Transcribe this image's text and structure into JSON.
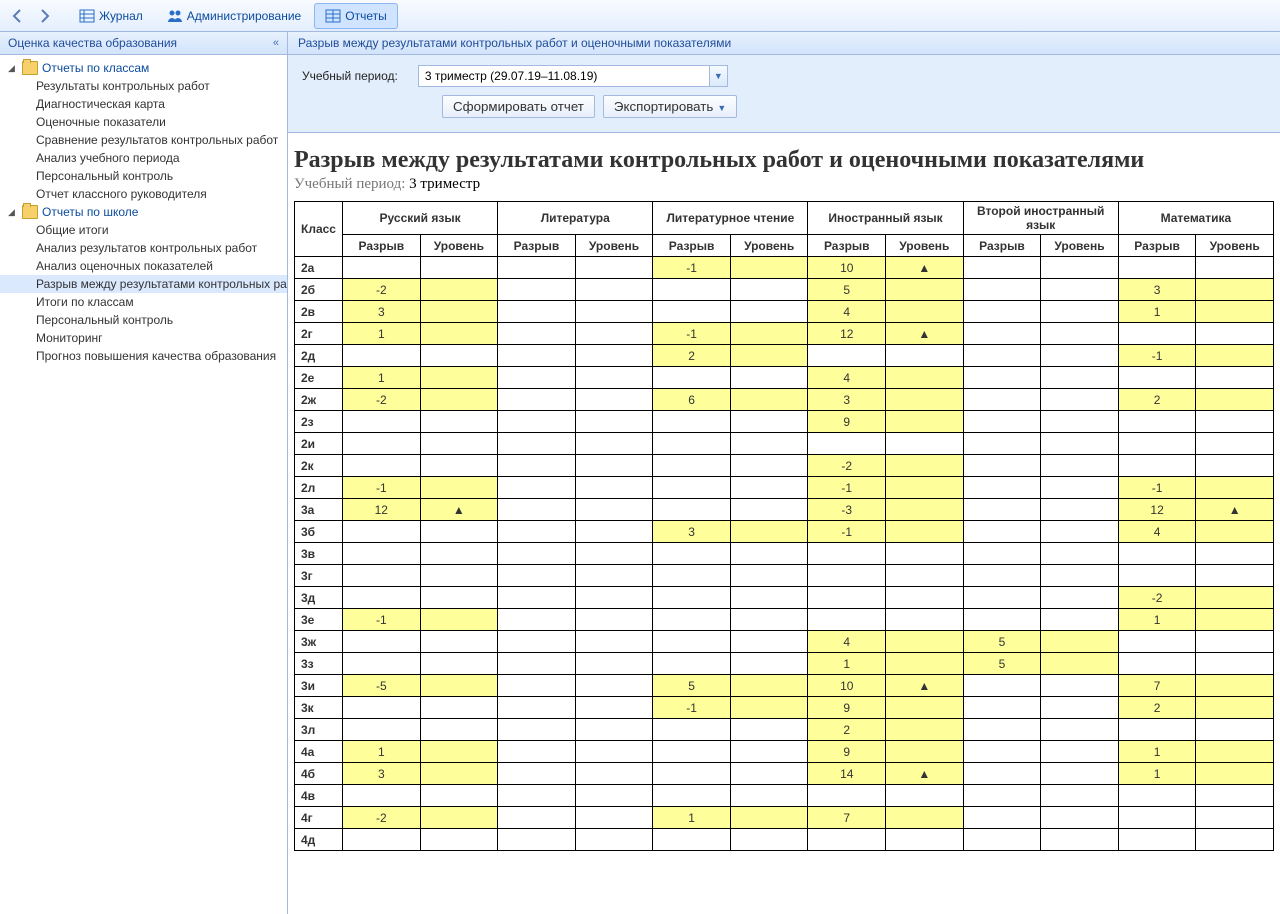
{
  "toolbar": {
    "tabs": [
      {
        "label": "Журнал"
      },
      {
        "label": "Администрирование"
      },
      {
        "label": "Отчеты"
      }
    ]
  },
  "sidebar": {
    "title": "Оценка качества образования",
    "groups": [
      {
        "label": "Отчеты по классам",
        "items": [
          "Результаты контрольных работ",
          "Диагностическая карта",
          "Оценочные показатели",
          "Сравнение результатов контрольных работ",
          "Анализ учебного периода",
          "Персональный контроль",
          "Отчет классного руководителя"
        ]
      },
      {
        "label": "Отчеты по школе",
        "items": [
          "Общие итоги",
          "Анализ результатов контрольных работ",
          "Анализ оценочных показателей",
          "Разрыв между результатами контрольных работ и оценочными показателями",
          "Итоги по классам",
          "Персональный контроль",
          "Мониторинг",
          "Прогноз повышения качества образования"
        ]
      }
    ],
    "selected": "Разрыв между результатами контрольных работ и оценочными показателями"
  },
  "main": {
    "header": "Разрыв между результатами контрольных работ и оценочными показателями",
    "period_label": "Учебный период:",
    "period_value": "3 триместр (29.07.19–11.08.19)",
    "generate_button": "Сформировать отчет",
    "export_button": "Экспортировать",
    "report_title": "Разрыв между результатами контрольных работ и оценочными показателями",
    "report_sub_label": "Учебный период:",
    "report_sub_value": "3 триместр"
  },
  "table": {
    "class_header": "Класс",
    "subcols": [
      "Разрыв",
      "Уровень"
    ],
    "subjects": [
      "Русский язык",
      "Литература",
      "Литературное чтение",
      "Иностранный язык",
      "Второй иностранный язык",
      "Математика"
    ],
    "rows": [
      {
        "cls": "2а",
        "cells": [
          [
            "",
            ""
          ],
          [
            "",
            ""
          ],
          [
            "-1",
            "",
            "hl"
          ],
          [
            "10",
            "▲",
            "hl"
          ],
          [
            "",
            ""
          ],
          [
            "",
            ""
          ]
        ]
      },
      {
        "cls": "2б",
        "cells": [
          [
            "-2",
            "",
            "hl"
          ],
          [
            "",
            ""
          ],
          [
            "",
            ""
          ],
          [
            "5",
            "",
            "hl"
          ],
          [
            "",
            ""
          ],
          [
            "3",
            "",
            "hl"
          ]
        ]
      },
      {
        "cls": "2в",
        "cells": [
          [
            "3",
            "",
            "hl"
          ],
          [
            "",
            ""
          ],
          [
            "",
            ""
          ],
          [
            "4",
            "",
            "hl"
          ],
          [
            "",
            ""
          ],
          [
            "1",
            "",
            "hl"
          ]
        ]
      },
      {
        "cls": "2г",
        "cells": [
          [
            "1",
            "",
            "hl"
          ],
          [
            "",
            ""
          ],
          [
            "-1",
            "",
            "hl"
          ],
          [
            "12",
            "▲",
            "hl"
          ],
          [
            "",
            ""
          ],
          [
            "",
            ""
          ]
        ]
      },
      {
        "cls": "2д",
        "cells": [
          [
            "",
            ""
          ],
          [
            "",
            ""
          ],
          [
            "2",
            "",
            "hl"
          ],
          [
            "",
            ""
          ],
          [
            "",
            ""
          ],
          [
            "-1",
            "",
            "hl"
          ]
        ]
      },
      {
        "cls": "2е",
        "cells": [
          [
            "1",
            "",
            "hl"
          ],
          [
            "",
            ""
          ],
          [
            "",
            ""
          ],
          [
            "4",
            "",
            "hl"
          ],
          [
            "",
            ""
          ],
          [
            "",
            ""
          ]
        ]
      },
      {
        "cls": "2ж",
        "cells": [
          [
            "-2",
            "",
            "hl"
          ],
          [
            "",
            ""
          ],
          [
            "6",
            "",
            "hl"
          ],
          [
            "3",
            "",
            "hl"
          ],
          [
            "",
            ""
          ],
          [
            "2",
            "",
            "hl"
          ]
        ]
      },
      {
        "cls": "2з",
        "cells": [
          [
            "",
            ""
          ],
          [
            "",
            ""
          ],
          [
            "",
            ""
          ],
          [
            "9",
            "",
            "hl"
          ],
          [
            "",
            ""
          ],
          [
            "",
            ""
          ]
        ]
      },
      {
        "cls": "2и",
        "cells": [
          [
            "",
            ""
          ],
          [
            "",
            ""
          ],
          [
            "",
            ""
          ],
          [
            "",
            ""
          ],
          [
            "",
            ""
          ],
          [
            "",
            ""
          ]
        ]
      },
      {
        "cls": "2к",
        "cells": [
          [
            "",
            ""
          ],
          [
            "",
            ""
          ],
          [
            "",
            ""
          ],
          [
            "-2",
            "",
            "hl"
          ],
          [
            "",
            ""
          ],
          [
            "",
            ""
          ]
        ]
      },
      {
        "cls": "2л",
        "cells": [
          [
            "-1",
            "",
            "hl"
          ],
          [
            "",
            ""
          ],
          [
            "",
            ""
          ],
          [
            "-1",
            "",
            "hl"
          ],
          [
            "",
            ""
          ],
          [
            "-1",
            "",
            "hl"
          ]
        ]
      },
      {
        "cls": "3а",
        "cells": [
          [
            "12",
            "▲",
            "hl"
          ],
          [
            "",
            ""
          ],
          [
            "",
            ""
          ],
          [
            "-3",
            "",
            "hl"
          ],
          [
            "",
            ""
          ],
          [
            "12",
            "▲",
            "hl"
          ]
        ]
      },
      {
        "cls": "3б",
        "cells": [
          [
            "",
            ""
          ],
          [
            "",
            ""
          ],
          [
            "3",
            "",
            "hl"
          ],
          [
            "-1",
            "",
            "hl"
          ],
          [
            "",
            ""
          ],
          [
            "4",
            "",
            "hl"
          ]
        ]
      },
      {
        "cls": "3в",
        "cells": [
          [
            "",
            ""
          ],
          [
            "",
            ""
          ],
          [
            "",
            ""
          ],
          [
            "",
            ""
          ],
          [
            "",
            ""
          ],
          [
            "",
            ""
          ]
        ]
      },
      {
        "cls": "3г",
        "cells": [
          [
            "",
            ""
          ],
          [
            "",
            ""
          ],
          [
            "",
            ""
          ],
          [
            "",
            ""
          ],
          [
            "",
            ""
          ],
          [
            "",
            ""
          ]
        ]
      },
      {
        "cls": "3д",
        "cells": [
          [
            "",
            ""
          ],
          [
            "",
            ""
          ],
          [
            "",
            ""
          ],
          [
            "",
            ""
          ],
          [
            "",
            ""
          ],
          [
            "-2",
            "",
            "hl"
          ]
        ]
      },
      {
        "cls": "3е",
        "cells": [
          [
            "-1",
            "",
            "hl"
          ],
          [
            "",
            ""
          ],
          [
            "",
            ""
          ],
          [
            "",
            ""
          ],
          [
            "",
            ""
          ],
          [
            "1",
            "",
            "hl"
          ]
        ]
      },
      {
        "cls": "3ж",
        "cells": [
          [
            "",
            ""
          ],
          [
            "",
            ""
          ],
          [
            "",
            ""
          ],
          [
            "4",
            "",
            "hl"
          ],
          [
            "5",
            "",
            "hl"
          ],
          [
            "",
            ""
          ]
        ]
      },
      {
        "cls": "3з",
        "cells": [
          [
            "",
            ""
          ],
          [
            "",
            ""
          ],
          [
            "",
            ""
          ],
          [
            "1",
            "",
            "hl"
          ],
          [
            "5",
            "",
            "hl"
          ],
          [
            "",
            ""
          ]
        ]
      },
      {
        "cls": "3и",
        "cells": [
          [
            "-5",
            "",
            "hl"
          ],
          [
            "",
            ""
          ],
          [
            "5",
            "",
            "hl"
          ],
          [
            "10",
            "▲",
            "hl"
          ],
          [
            "",
            ""
          ],
          [
            "7",
            "",
            "hl"
          ]
        ]
      },
      {
        "cls": "3к",
        "cells": [
          [
            "",
            ""
          ],
          [
            "",
            ""
          ],
          [
            "-1",
            "",
            "hl"
          ],
          [
            "9",
            "",
            "hl"
          ],
          [
            "",
            ""
          ],
          [
            "2",
            "",
            "hl"
          ]
        ]
      },
      {
        "cls": "3л",
        "cells": [
          [
            "",
            ""
          ],
          [
            "",
            ""
          ],
          [
            "",
            ""
          ],
          [
            "2",
            "",
            "hl"
          ],
          [
            "",
            ""
          ],
          [
            "",
            ""
          ]
        ]
      },
      {
        "cls": "4а",
        "cells": [
          [
            "1",
            "",
            "hl"
          ],
          [
            "",
            ""
          ],
          [
            "",
            ""
          ],
          [
            "9",
            "",
            "hl"
          ],
          [
            "",
            ""
          ],
          [
            "1",
            "",
            "hl"
          ]
        ]
      },
      {
        "cls": "4б",
        "cells": [
          [
            "3",
            "",
            "hl"
          ],
          [
            "",
            ""
          ],
          [
            "",
            ""
          ],
          [
            "14",
            "▲",
            "hl"
          ],
          [
            "",
            ""
          ],
          [
            "1",
            "",
            "hl"
          ]
        ]
      },
      {
        "cls": "4в",
        "cells": [
          [
            "",
            ""
          ],
          [
            "",
            ""
          ],
          [
            "",
            ""
          ],
          [
            "",
            ""
          ],
          [
            "",
            ""
          ],
          [
            "",
            ""
          ]
        ]
      },
      {
        "cls": "4г",
        "cells": [
          [
            "-2",
            "",
            "hl"
          ],
          [
            "",
            ""
          ],
          [
            "1",
            "",
            "hl"
          ],
          [
            "7",
            "",
            "hl"
          ],
          [
            "",
            ""
          ],
          [
            "",
            ""
          ]
        ]
      },
      {
        "cls": "4д",
        "cells": [
          [
            "",
            ""
          ],
          [
            "",
            ""
          ],
          [
            "",
            ""
          ],
          [
            "",
            ""
          ],
          [
            "",
            ""
          ],
          [
            "",
            ""
          ]
        ]
      }
    ]
  }
}
